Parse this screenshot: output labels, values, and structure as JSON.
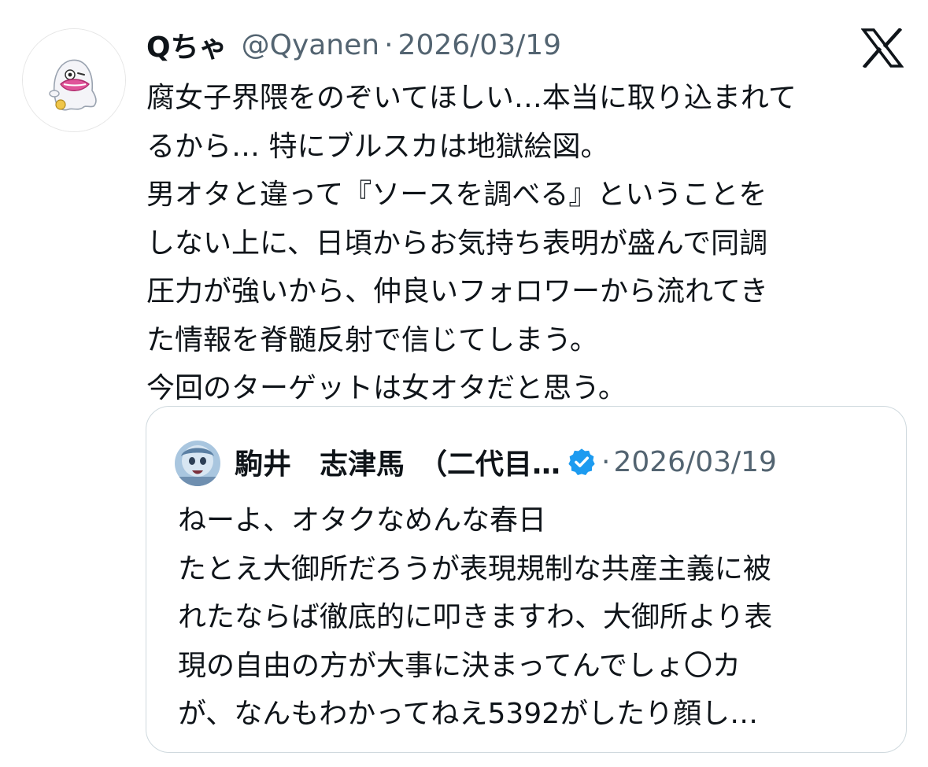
{
  "tweet": {
    "author": {
      "display_name": "Qちゃ",
      "handle": "@Qyanen",
      "avatar_icon": "cartoon-ghost-avatar"
    },
    "separator": "·",
    "date": "2026/03/19",
    "platform_icon": "x-logo-icon",
    "text_lines": [
      "腐女子界隈をのぞいてほしい…本当に取り込まれて",
      "るから… 特にブルスカは地獄絵図。",
      "男オタと違って『ソースを調べる』ということを",
      "しない上に、日頃からお気持ち表明が盛んで同調",
      "圧力が強いから、仲良いフォロワーから流れてき",
      "た情報を脊髄反射で信じてしまう。",
      "今回のターゲットは女オタだと思う。"
    ]
  },
  "quoted_tweet": {
    "author": {
      "display_name": "駒井　志津馬　（二代目…",
      "verified": true,
      "avatar_icon": "anime-character-avatar"
    },
    "separator": "·",
    "date": "2026/03/19",
    "text_lines": [
      "ねーよ、オタクなめんな春日",
      "たとえ大御所だろうが表現規制な共産主義に被",
      "れたならば徹底的に叩きますわ、大御所より表",
      "現の自由の方が大事に決まってんでしょ〇カ",
      "が、なんもわかってねえ5392がしたり顔し…"
    ]
  },
  "colors": {
    "text_primary": "#0f1419",
    "text_secondary": "#536471",
    "border": "#cfd9de",
    "verified_blue": "#1d9bf0"
  }
}
